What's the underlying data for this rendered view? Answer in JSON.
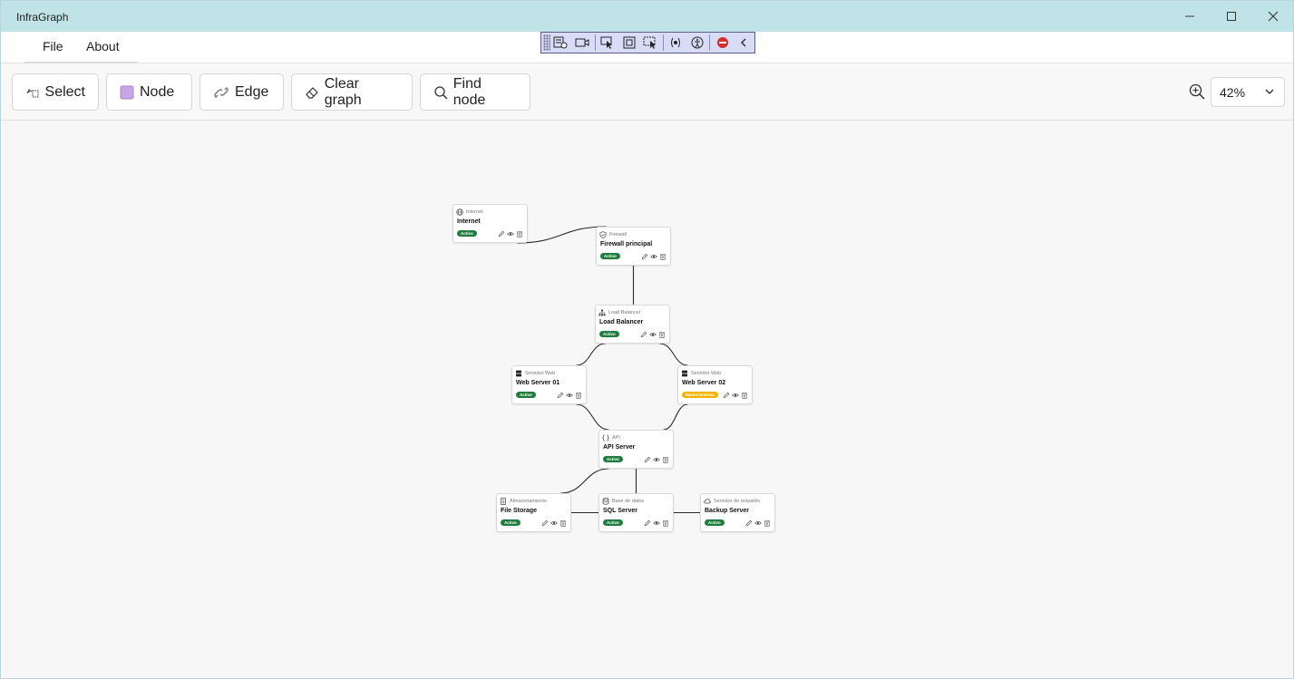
{
  "window": {
    "title": "InfraGraph"
  },
  "menu": {
    "items": [
      "File",
      "About"
    ]
  },
  "toolbar": {
    "select_label": "Select",
    "node_label": "Node",
    "edge_label": "Edge",
    "clear_label": "Clear graph",
    "find_label": "Find node",
    "zoom_value": "42%"
  },
  "colors": {
    "titlebar": "#bfe3e6",
    "active": "#1e7d3c",
    "maintenance": "#f5b400",
    "node_icon": "#c8a6e6"
  },
  "graph": {
    "nodes": [
      {
        "id": "internet",
        "type": "Internet",
        "name": "Internet",
        "status": "Activo",
        "status_kind": "active",
        "icon": "globe-icon"
      },
      {
        "id": "firewall",
        "type": "Firewall",
        "name": "Firewall principal",
        "status": "Activo",
        "status_kind": "active",
        "icon": "shield-icon"
      },
      {
        "id": "lb",
        "type": "Load Balancer",
        "name": "Load Balancer",
        "status": "Activo",
        "status_kind": "active",
        "icon": "network-icon"
      },
      {
        "id": "web1",
        "type": "Servidor Web",
        "name": "Web Server 01",
        "status": "Activo",
        "status_kind": "active",
        "icon": "server-icon"
      },
      {
        "id": "web2",
        "type": "Servidor Web",
        "name": "Web Server 02",
        "status": "Mantenimiento",
        "status_kind": "maintenance",
        "icon": "server-icon"
      },
      {
        "id": "api",
        "type": "API",
        "name": "API Server",
        "status": "Activo",
        "status_kind": "active",
        "icon": "braces-icon"
      },
      {
        "id": "files",
        "type": "Almacenamiento",
        "name": "File Storage",
        "status": "Activo",
        "status_kind": "active",
        "icon": "file-icon"
      },
      {
        "id": "sql",
        "type": "Base de datos",
        "name": "SQL Server",
        "status": "Activo",
        "status_kind": "active",
        "icon": "database-icon"
      },
      {
        "id": "backup",
        "type": "Servidor de respaldo",
        "name": "Backup Server",
        "status": "Activo",
        "status_kind": "active",
        "icon": "cloud-icon"
      }
    ],
    "edges": [
      [
        "internet",
        "firewall"
      ],
      [
        "firewall",
        "lb"
      ],
      [
        "lb",
        "web1"
      ],
      [
        "lb",
        "web2"
      ],
      [
        "web1",
        "api"
      ],
      [
        "web2",
        "api"
      ],
      [
        "api",
        "files"
      ],
      [
        "api",
        "sql"
      ],
      [
        "files",
        "sql"
      ],
      [
        "sql",
        "backup"
      ]
    ]
  }
}
